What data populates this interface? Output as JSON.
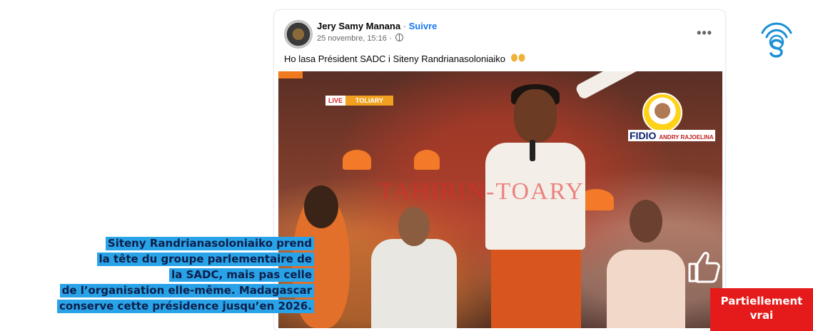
{
  "post": {
    "author": "Jery Samy Manana",
    "separator": " · ",
    "follow_label": "Suivre",
    "timestamp": "25 novembre, 15:16 ·",
    "text": "Ho lasa Président SADC i Siteny Randrianasoloniaiko",
    "more_icon": "more-dots-icon"
  },
  "video": {
    "live_tag": "LIVE",
    "live_location": "TOLIARY",
    "watermark": "TAHIRIN-TOARY",
    "logo_text": "FIDIO",
    "logo_sub": "ANDRY RAJOELINA"
  },
  "caption": {
    "lines": [
      "Siteny Randrianasoloniaiko prend",
      "la tête du groupe parlementaire de",
      "la SADC, mais pas celle",
      "de l’organisation elle-même. Madagascar",
      "conserve cette présidence jusqu’en 2026."
    ]
  },
  "verdict": {
    "line1": "Partiellement",
    "line2": "vrai",
    "color": "#e51b1b"
  },
  "colors": {
    "accent": "#1877f2",
    "caption_bg": "#29a3e8",
    "caption_text": "#0d1f4a",
    "brand": "#1a8fd6"
  }
}
